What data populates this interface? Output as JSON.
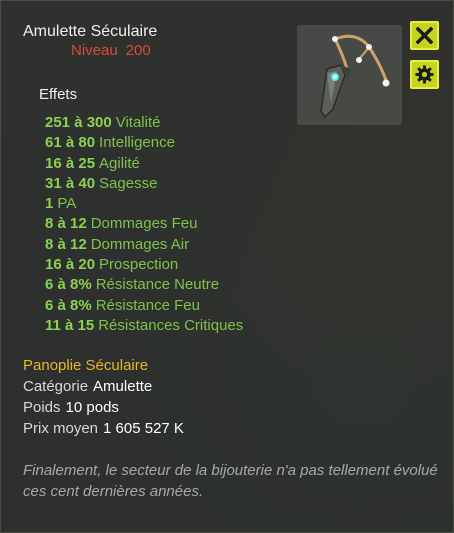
{
  "item": {
    "name": "Amulette Séculaire",
    "level_label": "Niveau",
    "level_value": "200",
    "image_icon": "amulet-icon"
  },
  "buttons": {
    "close_icon": "close-icon",
    "settings_icon": "gear-icon"
  },
  "effects": {
    "title": "Effets",
    "items": [
      {
        "range": "251 à 300",
        "stat": "Vitalité"
      },
      {
        "range": "61 à 80",
        "stat": "Intelligence"
      },
      {
        "range": "16 à 25",
        "stat": "Agilité"
      },
      {
        "range": "31 à 40",
        "stat": "Sagesse"
      },
      {
        "range": "1",
        "stat": "PA"
      },
      {
        "range": "8 à 12",
        "stat": "Dommages Feu"
      },
      {
        "range": "8 à 12",
        "stat": "Dommages Air"
      },
      {
        "range": "16 à 20",
        "stat": "Prospection"
      },
      {
        "range": "6 à 8%",
        "stat": "Résistance Neutre"
      },
      {
        "range": "6 à 8%",
        "stat": "Résistance Feu"
      },
      {
        "range": "11 à 15",
        "stat": "Résistances Critiques"
      }
    ]
  },
  "details": {
    "set_name": "Panoplie Séculaire",
    "category_label": "Catégorie",
    "category_value": "Amulette",
    "weight_label": "Poids",
    "weight_value": "10 pods",
    "price_label": "Prix moyen",
    "price_value": "1 605 527 K"
  },
  "flavor_text": "Finalement, le secteur de la bijouterie n'a pas tellement évolué ces cent dernières années.",
  "colors": {
    "effect_green": "#7fc34a",
    "level_red": "#d94a3a",
    "set_gold": "#e8b62a",
    "button_yellow": "#c6d31f"
  }
}
